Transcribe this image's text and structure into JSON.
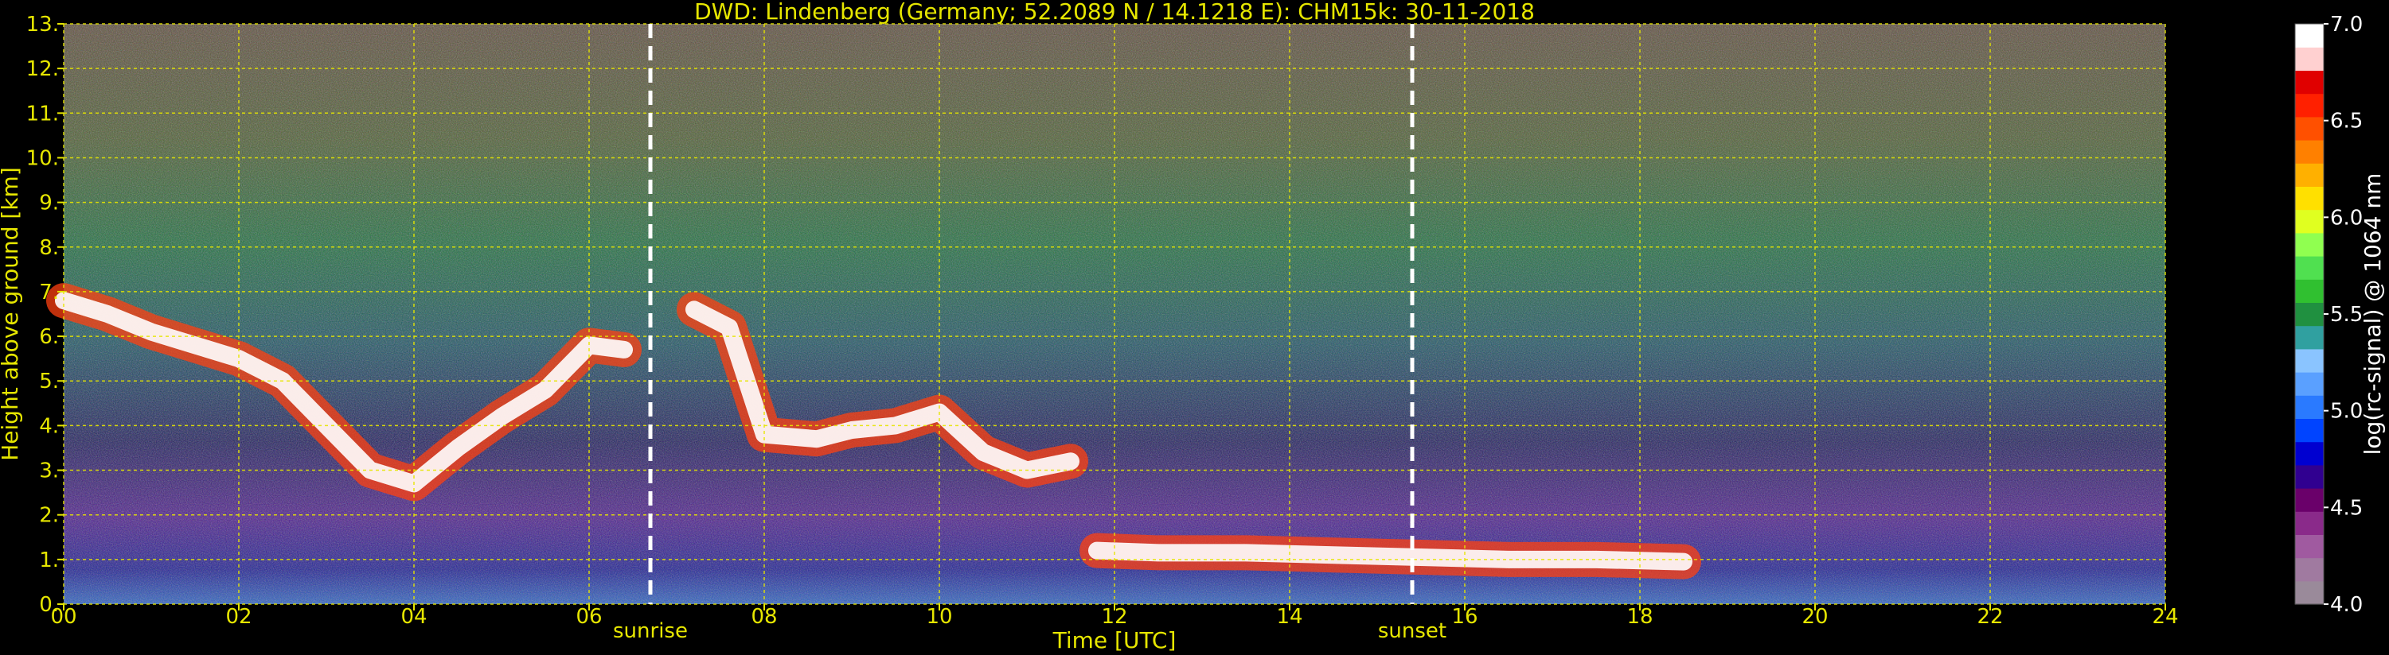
{
  "chart_data": {
    "type": "heatmap",
    "title": "DWD: Lindenberg (Germany; 52.2089 N / 14.1218 E):     CHM15k: 30-11-2018",
    "xlabel": "Time [UTC]",
    "ylabel": "Height above ground [km]",
    "xlim": [
      0,
      24
    ],
    "ylim": [
      0,
      13
    ],
    "x_ticks": [
      0,
      2,
      4,
      6,
      8,
      10,
      12,
      14,
      16,
      18,
      20,
      22,
      24
    ],
    "x_tick_labels": [
      "00",
      "02",
      "04",
      "06",
      "08",
      "10",
      "12",
      "14",
      "16",
      "18",
      "20",
      "22",
      "24"
    ],
    "y_ticks": [
      0,
      1,
      2,
      3,
      4,
      5,
      6,
      7,
      8,
      9,
      10,
      11,
      12,
      13
    ],
    "y_tick_labels": [
      "0.",
      "1.",
      "2.",
      "3.",
      "4.",
      "5.",
      "6.",
      "7.",
      "8.",
      "9.",
      "10.",
      "11.",
      "12.",
      "13."
    ],
    "grid": true,
    "markers": [
      {
        "label": "sunrise",
        "x": 6.7
      },
      {
        "label": "sunset",
        "x": 15.4
      }
    ],
    "colorbar": {
      "label": "log(rc-signal) @ 1064 nm",
      "range": [
        4.0,
        7.0
      ],
      "ticks": [
        4.0,
        4.5,
        5.0,
        5.5,
        6.0,
        6.5,
        7.0
      ],
      "tick_labels": [
        "4.0",
        "4.5",
        "5.0",
        "5.5",
        "6.0",
        "6.5",
        "7.0"
      ],
      "colors": [
        "#9a8a9a",
        "#a07aa0",
        "#a05aa0",
        "#8a2a8a",
        "#6a006a",
        "#300090",
        "#0000d0",
        "#0044ff",
        "#2a7aff",
        "#5aa0ff",
        "#8ac4ff",
        "#30a0a0",
        "#209040",
        "#30c030",
        "#50e050",
        "#90ff50",
        "#e0ff20",
        "#ffe000",
        "#ffb000",
        "#ff8000",
        "#ff5000",
        "#ff2000",
        "#e00000",
        "#ffd0d0",
        "#ffffff"
      ]
    },
    "features": [
      {
        "description": "cloud layer",
        "x": [
          0.0,
          0.5,
          1.0,
          1.5,
          2.0,
          2.5,
          3.0,
          3.5,
          4.0,
          4.5,
          5.0,
          5.5,
          6.0,
          6.4
        ],
        "y": [
          6.8,
          6.5,
          6.1,
          5.8,
          5.5,
          5.0,
          4.0,
          3.0,
          2.7,
          3.5,
          4.2,
          4.8,
          5.8,
          5.7
        ]
      },
      {
        "description": "cloud layer",
        "x": [
          7.2,
          7.6,
          8.0,
          8.6,
          9.0,
          9.5,
          10.0,
          10.5,
          11.0,
          11.5
        ],
        "y": [
          6.6,
          6.2,
          3.8,
          3.7,
          3.9,
          4.0,
          4.3,
          3.4,
          3.0,
          3.2
        ]
      },
      {
        "description": "boundary layer top",
        "x": [
          11.8,
          12.5,
          13.5,
          14.5,
          15.5,
          16.5,
          17.5,
          18.5
        ],
        "y": [
          1.2,
          1.15,
          1.15,
          1.1,
          1.05,
          1.0,
          1.0,
          0.95
        ]
      }
    ]
  }
}
